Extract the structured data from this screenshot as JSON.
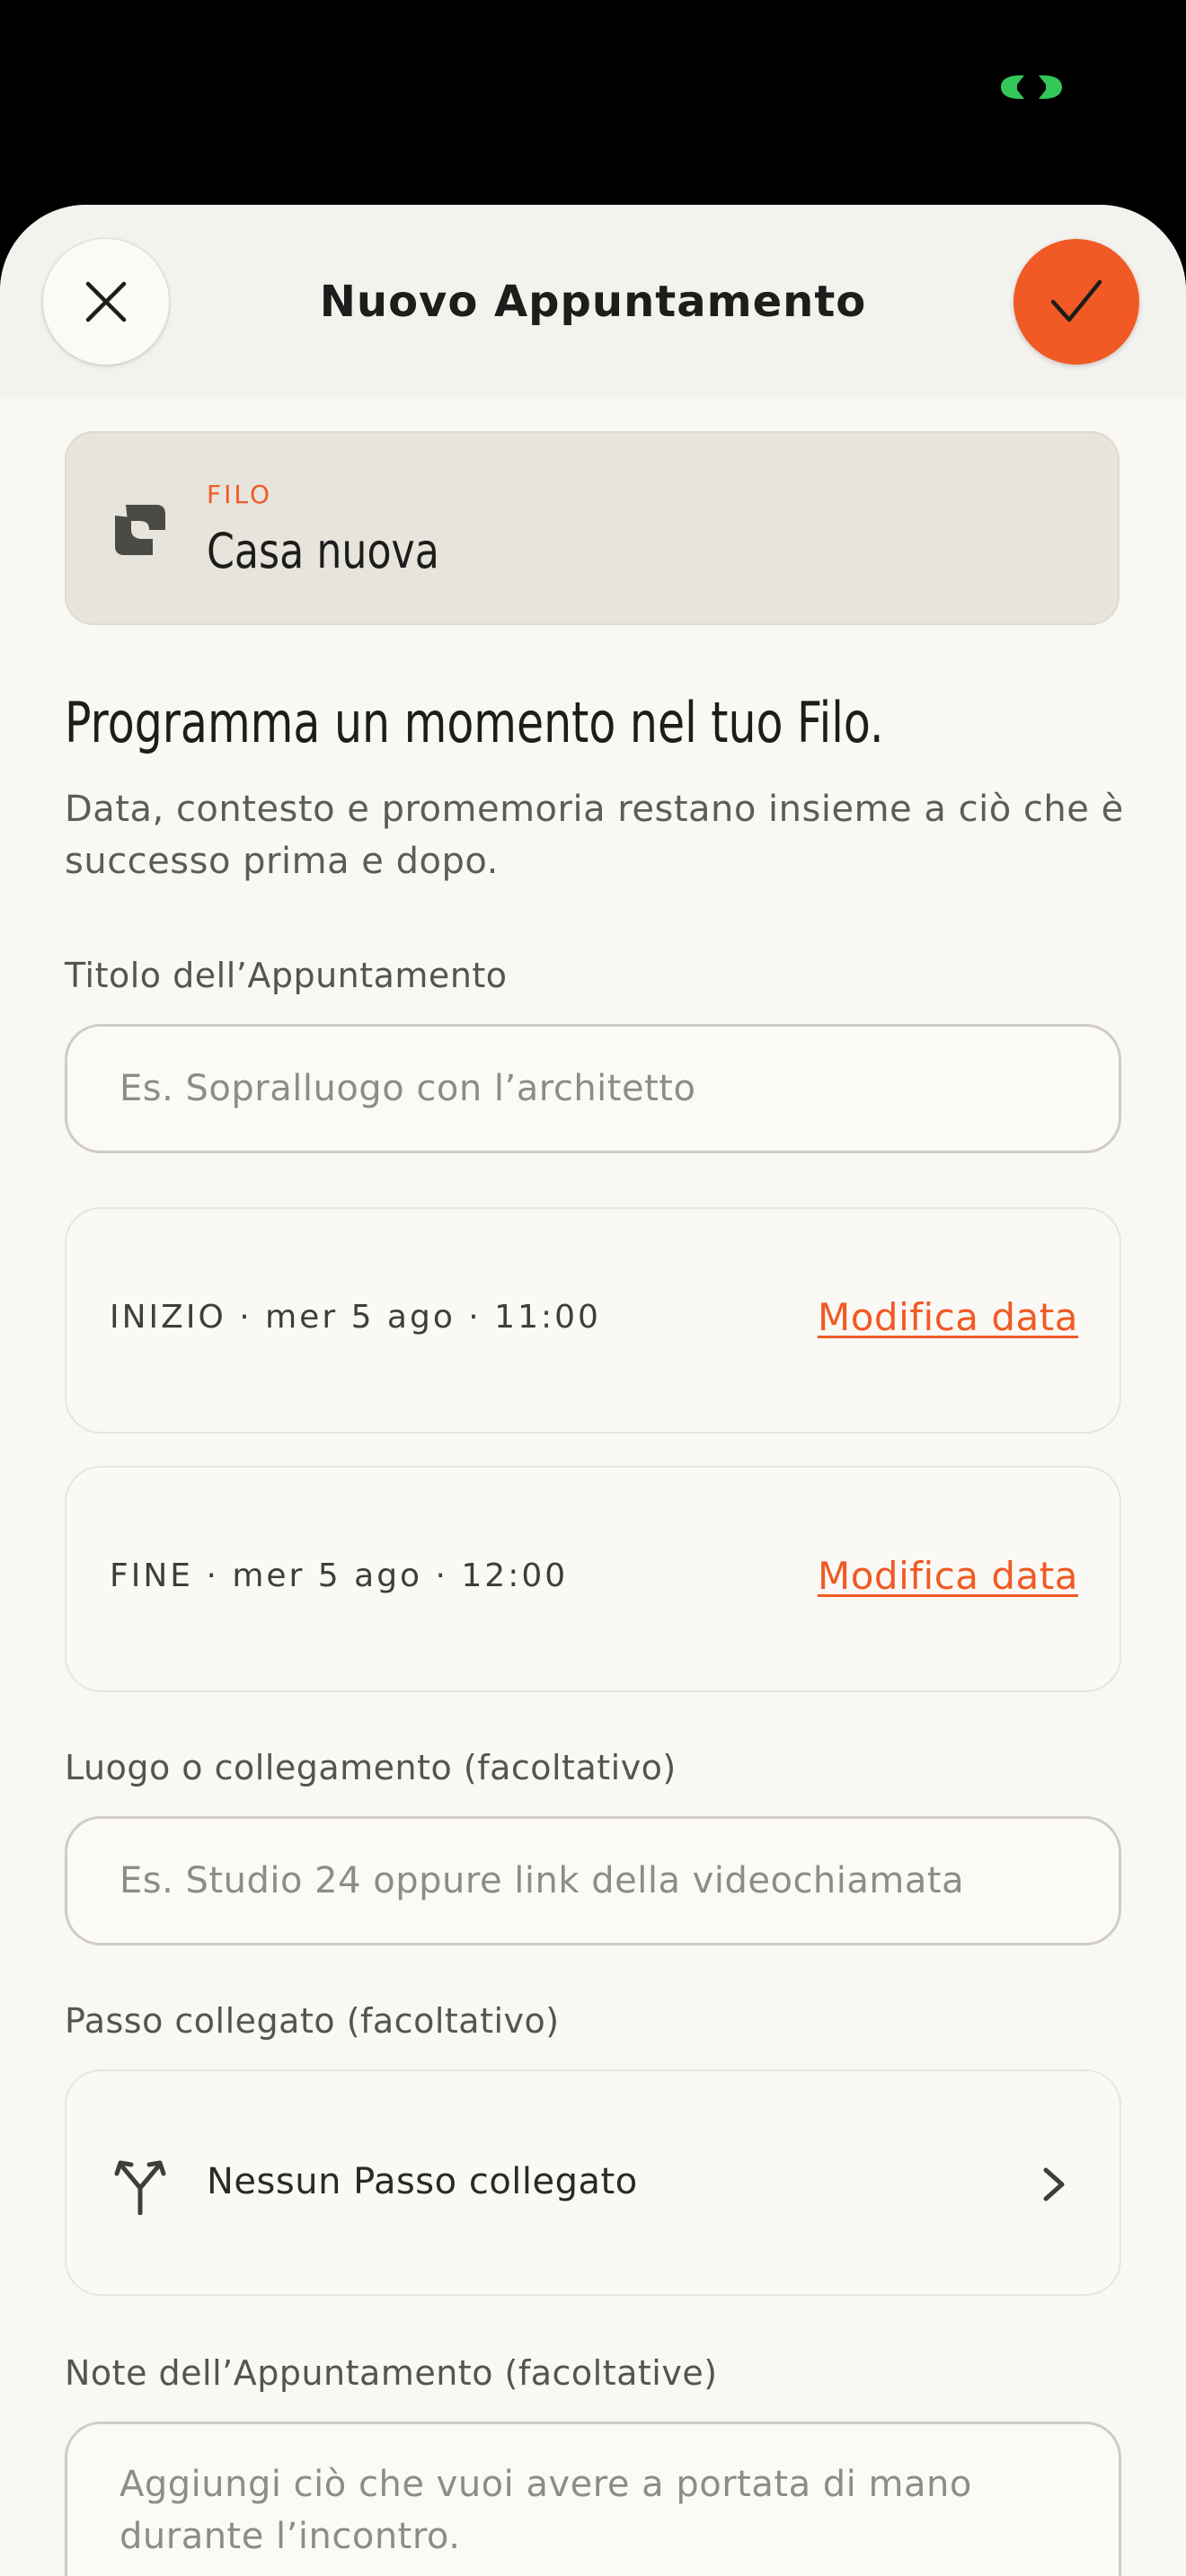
{
  "colors": {
    "accent": "#f15a24",
    "sheet_background": "#f9f8f4",
    "header_background": "#f3f2ee",
    "card_background": "#e7e4dc",
    "status_indicator": "#34c759"
  },
  "status_bar": {
    "indicator_icon": "green-link-indicator-icon"
  },
  "header": {
    "title": "Nuovo Appuntamento",
    "close_icon": "close-icon",
    "confirm_icon": "checkmark-icon"
  },
  "filo": {
    "kicker": "FILO",
    "name": "Casa nuova",
    "icon": "filo-thread-icon"
  },
  "intro": {
    "heading": "Programma un momento nel tuo Filo.",
    "body": "Data, contesto e promemoria restano insieme a ciò che è successo prima e dopo."
  },
  "title_field": {
    "label": "Titolo dell’Appuntamento",
    "value": "",
    "placeholder": "Es. Sopralluogo con l’architetto"
  },
  "start": {
    "text": "INIZIO · mer 5 ago · 11:00",
    "action": "Modifica data"
  },
  "end": {
    "text": "FINE · mer 5 ago · 12:00",
    "action": "Modifica data"
  },
  "location_field": {
    "label": "Luogo o collegamento (facoltativo)",
    "value": "",
    "placeholder": "Es. Studio 24 oppure link della videochiamata"
  },
  "linked_step": {
    "label": "Passo collegato (facoltativo)",
    "value": "Nessun Passo collegato",
    "icon": "branch-icon",
    "chevron_icon": "chevron-right-icon"
  },
  "notes_field": {
    "label": "Note dell’Appuntamento (facoltative)",
    "value": "",
    "placeholder": "Aggiungi ciò che vuoi avere a portata di mano durante l’incontro."
  }
}
